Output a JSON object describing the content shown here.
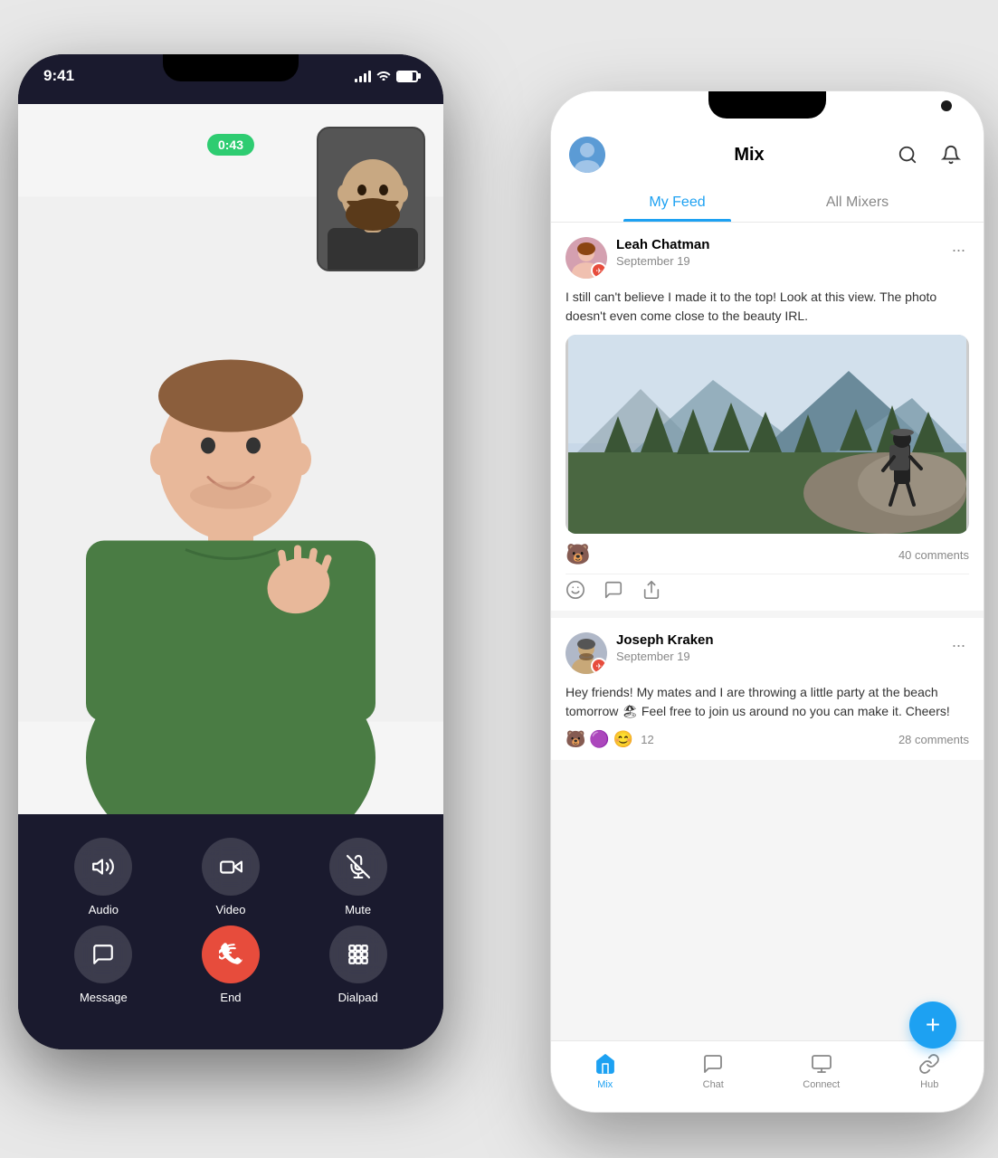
{
  "leftPhone": {
    "statusBar": {
      "time": "9:41",
      "signal": "full",
      "wifi": true,
      "battery": "full"
    },
    "call": {
      "timer": "0:43",
      "controls": {
        "row1": [
          {
            "id": "audio",
            "label": "Audio",
            "icon": "volume"
          },
          {
            "id": "video",
            "label": "Video",
            "icon": "video-camera"
          },
          {
            "id": "mute",
            "label": "Mute",
            "icon": "mic-off"
          }
        ],
        "row2": [
          {
            "id": "message",
            "label": "Message",
            "icon": "chat"
          },
          {
            "id": "end",
            "label": "End",
            "icon": "phone-end",
            "type": "red"
          },
          {
            "id": "dialpad",
            "label": "Dialpad",
            "icon": "grid"
          }
        ]
      }
    }
  },
  "rightPhone": {
    "header": {
      "title": "Mix",
      "searchLabel": "search",
      "notifLabel": "notifications"
    },
    "tabs": [
      {
        "id": "myfeed",
        "label": "My Feed",
        "active": true
      },
      {
        "id": "allmixers",
        "label": "All Mixers",
        "active": false
      }
    ],
    "posts": [
      {
        "id": "post1",
        "author": "Leah Chatman",
        "date": "September 19",
        "text": "I still can't believe I made it to the top! Look at this view. The photo doesn't even come close to the beauty IRL.",
        "hasImage": true,
        "imageAlt": "Mountain hiking view",
        "reactionEmoji": "🐻",
        "commentsCount": "40 comments",
        "moreOptionsLabel": "..."
      },
      {
        "id": "post2",
        "author": "Joseph Kraken",
        "date": "September 19",
        "text": "Hey friends! My mates and I are throwing a little party at the beach tomorrow 🏖 Feel free to join us around no you can make it. Cheers!",
        "hasImage": false,
        "reactionEmojis": [
          "🐻",
          "🟣",
          "😊"
        ],
        "reactionsCount": "12",
        "commentsCount": "28 comments",
        "moreOptionsLabel": "..."
      }
    ],
    "fab": {
      "label": "+"
    },
    "bottomNav": [
      {
        "id": "mix",
        "label": "Mix",
        "active": true
      },
      {
        "id": "chat",
        "label": "Chat",
        "active": false
      },
      {
        "id": "connect",
        "label": "Connect",
        "active": false
      },
      {
        "id": "hub",
        "label": "Hub",
        "active": false
      }
    ]
  }
}
